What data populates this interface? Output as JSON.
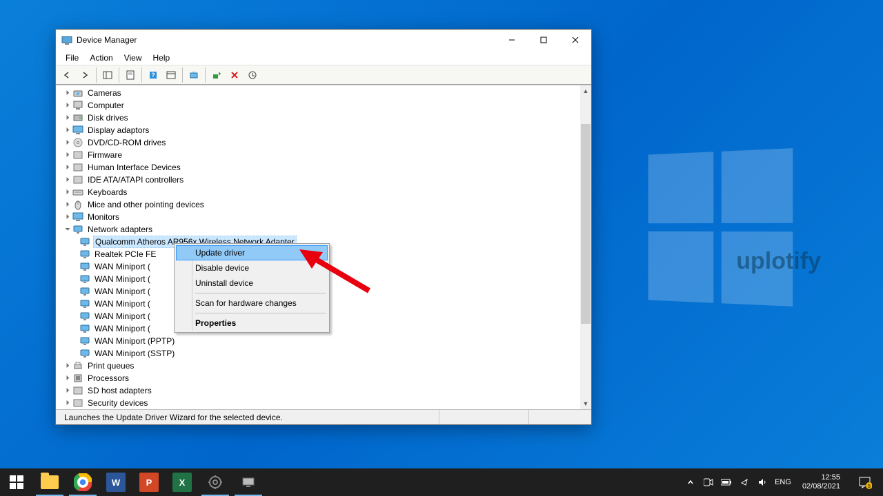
{
  "window": {
    "title": "Device Manager",
    "menu": {
      "file": "File",
      "action": "Action",
      "view": "View",
      "help": "Help"
    },
    "status": "Launches the Update Driver Wizard for the selected device."
  },
  "tree": {
    "categories": [
      {
        "id": "cameras",
        "label": "Cameras",
        "expanded": false,
        "icon": "camera"
      },
      {
        "id": "computer",
        "label": "Computer",
        "expanded": false,
        "icon": "computer"
      },
      {
        "id": "disk",
        "label": "Disk drives",
        "expanded": false,
        "icon": "disk"
      },
      {
        "id": "display",
        "label": "Display adaptors",
        "expanded": false,
        "icon": "display"
      },
      {
        "id": "dvd",
        "label": "DVD/CD-ROM drives",
        "expanded": false,
        "icon": "dvd"
      },
      {
        "id": "firmware",
        "label": "Firmware",
        "expanded": false,
        "icon": "firmware"
      },
      {
        "id": "hid",
        "label": "Human Interface Devices",
        "expanded": false,
        "icon": "hid"
      },
      {
        "id": "ide",
        "label": "IDE ATA/ATAPI controllers",
        "expanded": false,
        "icon": "ide"
      },
      {
        "id": "keyboards",
        "label": "Keyboards",
        "expanded": false,
        "icon": "keyboard"
      },
      {
        "id": "mice",
        "label": "Mice and other pointing devices",
        "expanded": false,
        "icon": "mouse"
      },
      {
        "id": "monitors",
        "label": "Monitors",
        "expanded": false,
        "icon": "monitor"
      },
      {
        "id": "network",
        "label": "Network adapters",
        "expanded": true,
        "icon": "network",
        "children": [
          {
            "label": "Qualcomm Atheros AR956x Wireless Network Adapter",
            "selected": true
          },
          {
            "label": "Realtek PCIe FE "
          },
          {
            "label": "WAN Miniport ("
          },
          {
            "label": "WAN Miniport ("
          },
          {
            "label": "WAN Miniport ("
          },
          {
            "label": "WAN Miniport ("
          },
          {
            "label": "WAN Miniport ("
          },
          {
            "label": "WAN Miniport ("
          },
          {
            "label": "WAN Miniport (PPTP)"
          },
          {
            "label": "WAN Miniport (SSTP)"
          }
        ]
      },
      {
        "id": "print",
        "label": "Print queues",
        "expanded": false,
        "icon": "print"
      },
      {
        "id": "processors",
        "label": "Processors",
        "expanded": false,
        "icon": "cpu"
      },
      {
        "id": "sd",
        "label": "SD host adapters",
        "expanded": false,
        "icon": "sd"
      },
      {
        "id": "security",
        "label": "Security devices",
        "expanded": false,
        "icon": "security"
      }
    ]
  },
  "contextmenu": {
    "update": "Update driver",
    "disable": "Disable device",
    "uninstall": "Uninstall device",
    "scan": "Scan for hardware changes",
    "properties": "Properties"
  },
  "watermark": "uplotify",
  "taskbar": {
    "lang": "ENG",
    "time": "12:55",
    "date": "02/08/2021",
    "notif_count": "5"
  }
}
